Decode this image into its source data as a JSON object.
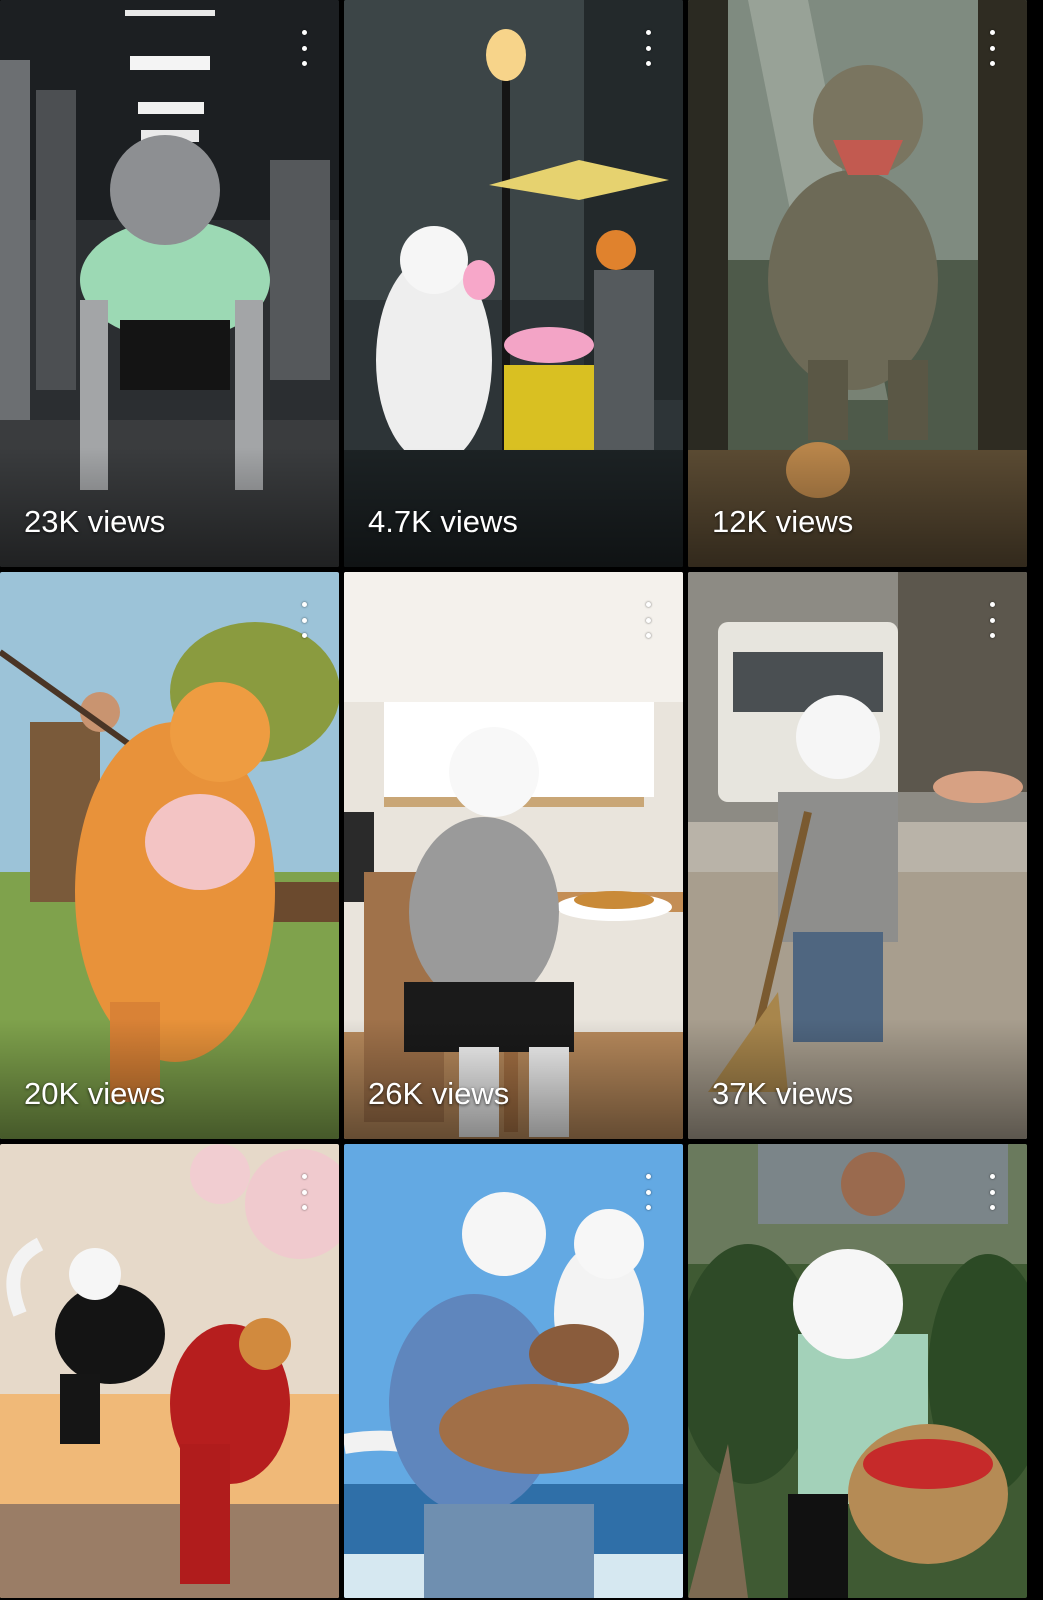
{
  "videos": [
    {
      "views": "23K views",
      "icon": "more-vert-icon"
    },
    {
      "views": "4.7K views",
      "icon": "more-vert-icon"
    },
    {
      "views": "12K views",
      "icon": "more-vert-icon"
    },
    {
      "views": "20K views",
      "icon": "more-vert-icon"
    },
    {
      "views": "26K views",
      "icon": "more-vert-icon"
    },
    {
      "views": "37K views",
      "icon": "more-vert-icon"
    },
    {
      "views": "",
      "icon": "more-vert-icon"
    },
    {
      "views": "",
      "icon": "more-vert-icon"
    },
    {
      "views": "",
      "icon": "more-vert-icon"
    }
  ]
}
